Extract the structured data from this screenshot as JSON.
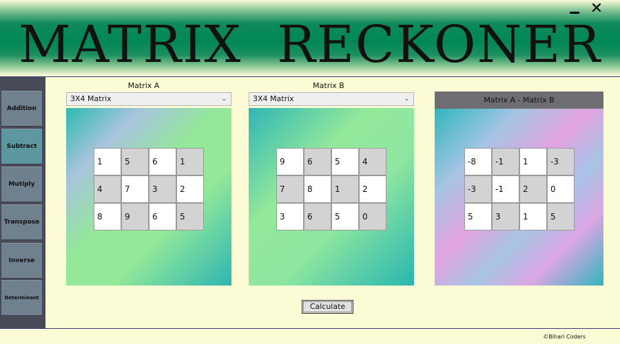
{
  "app": {
    "title": "MATRIX  RECKONER",
    "minimize_label": "",
    "close_label": "✕",
    "footer": "©Bihari Coders"
  },
  "sidebar": {
    "items": [
      {
        "label": "Addition"
      },
      {
        "label": "Subtract",
        "active": true
      },
      {
        "label": "Mutiply"
      },
      {
        "label": "Transpose"
      },
      {
        "label": "Inverse"
      },
      {
        "label": "Determinant"
      }
    ]
  },
  "matrix_a": {
    "label": "Matrix A",
    "select_value": "3X4  Matrix",
    "cells": [
      [
        "1",
        "5",
        "6",
        "1"
      ],
      [
        "4",
        "7",
        "3",
        "2"
      ],
      [
        "8",
        "9",
        "6",
        "5"
      ]
    ]
  },
  "matrix_b": {
    "label": "Matrix B",
    "select_value": "3X4  Matrix",
    "cells": [
      [
        "9",
        "6",
        "5",
        "4"
      ],
      [
        "7",
        "8",
        "1",
        "2"
      ],
      [
        "3",
        "6",
        "5",
        "0"
      ]
    ]
  },
  "result": {
    "header": "Matrix A - Matrix B",
    "cells": [
      [
        "-8",
        "-1",
        "1",
        "-3"
      ],
      [
        "-3",
        "-1",
        "2",
        "0"
      ],
      [
        "5",
        "3",
        "1",
        "5"
      ]
    ]
  },
  "calculate_label": "Calculate",
  "icons": {
    "dropdown": "chevron-down-icon"
  },
  "colors": {
    "header_green": "#008756",
    "background": "#fbfbd6",
    "sidebar": "#484b57",
    "active_tab": "#5d98a0"
  }
}
